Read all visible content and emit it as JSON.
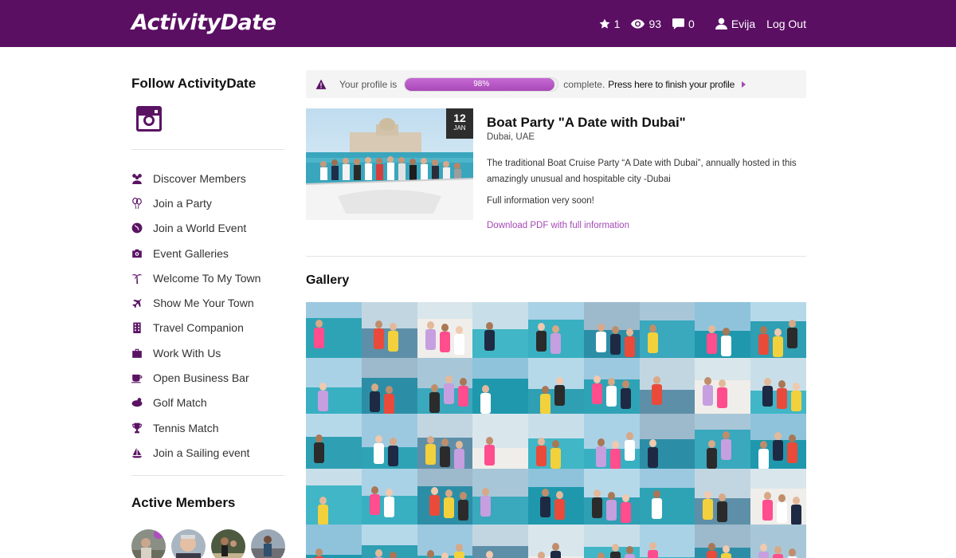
{
  "header": {
    "logo": "ActivityDate",
    "stars": "1",
    "views": "93",
    "messages": "0",
    "user": "Evija",
    "logout": "Log Out"
  },
  "sidebar": {
    "follow_heading": "Follow ActivityDate",
    "social_icon": "instagram-icon",
    "items": [
      {
        "label": "Discover Members",
        "icon": "members-icon"
      },
      {
        "label": "Join a Party",
        "icon": "balloons-icon"
      },
      {
        "label": "Join a World Event",
        "icon": "globe-icon"
      },
      {
        "label": "Event Galleries",
        "icon": "camera-icon"
      },
      {
        "label": "Welcome To My Town",
        "icon": "palm-tree-icon"
      },
      {
        "label": "Show Me Your Town",
        "icon": "plane-icon"
      },
      {
        "label": "Travel Companion",
        "icon": "building-icon"
      },
      {
        "label": "Work With Us",
        "icon": "briefcase-icon"
      },
      {
        "label": "Open Business Bar",
        "icon": "coffee-icon"
      },
      {
        "label": "Golf Match",
        "icon": "golf-icon"
      },
      {
        "label": "Tennis Match",
        "icon": "trophy-icon"
      },
      {
        "label": "Join a Sailing event",
        "icon": "sailboat-icon"
      }
    ],
    "active_heading": "Active Members"
  },
  "profile": {
    "label": "Your profile is",
    "percent": 98,
    "percent_text": "98%",
    "after": "complete.",
    "link": "Press here to finish your profile"
  },
  "event": {
    "day": "12",
    "month": "JAN",
    "title": "Boat Party \"A Date with Dubai\"",
    "location": "Dubai, UAE",
    "description": "The traditional Boat Cruise Party “A Date with Dubai”, annually hosted in this amazingly unusual and hospitable city -Dubai",
    "note": "Full information very soon!",
    "pdf_link": "Download PDF with full information"
  },
  "gallery": {
    "title": "Gallery"
  },
  "colors": {
    "brand": "#5a0f63",
    "accent": "#a548b5"
  }
}
